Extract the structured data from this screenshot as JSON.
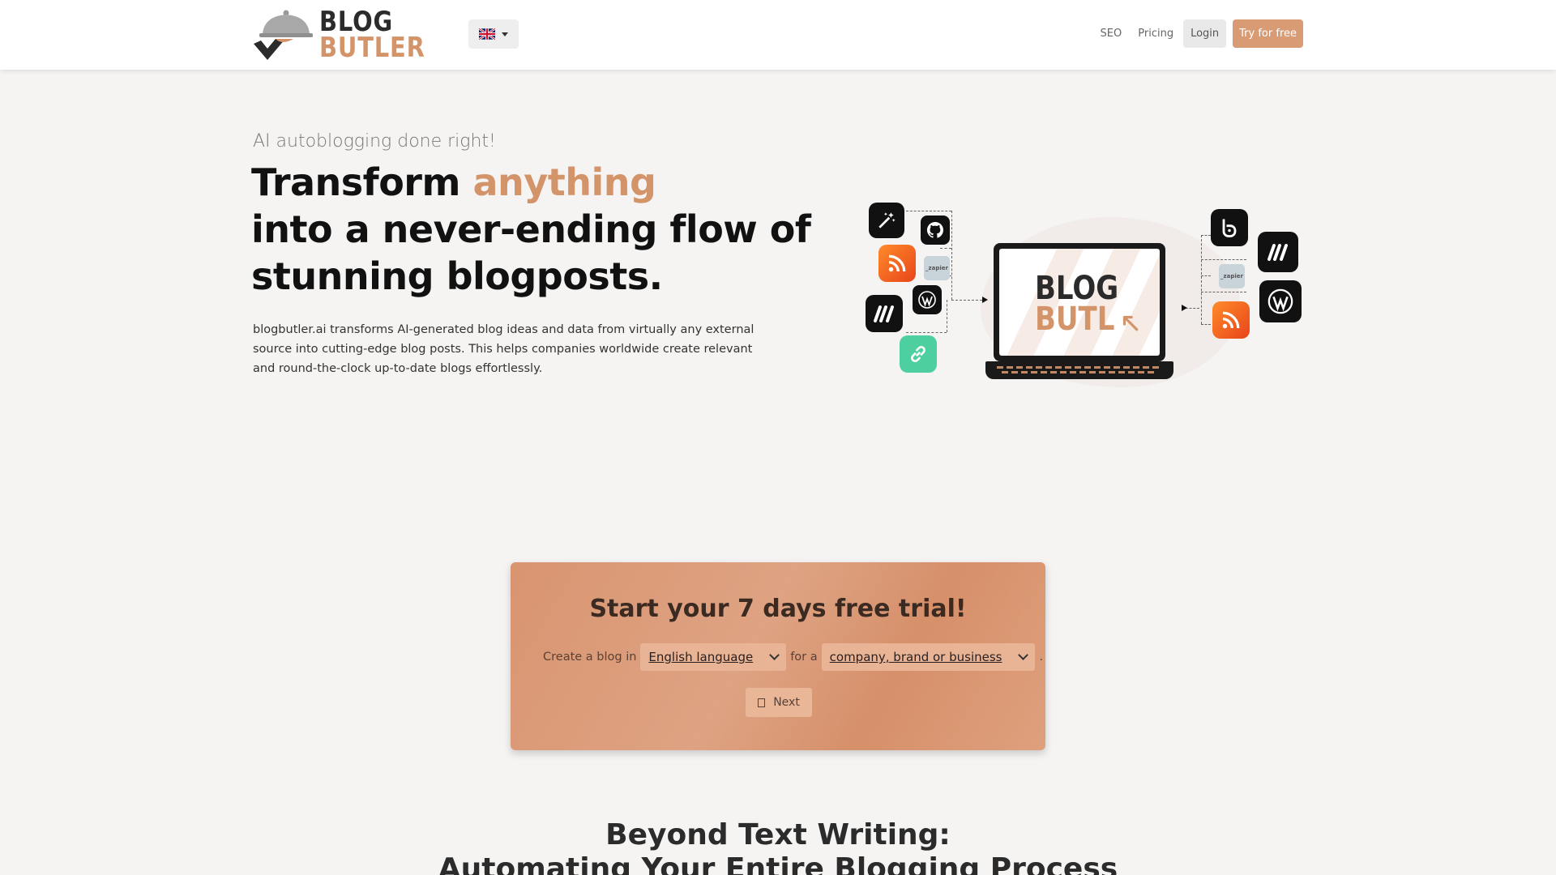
{
  "brand": {
    "line1": "BLOG",
    "line2": "BUTLER"
  },
  "nav": {
    "language": "en-GB",
    "links": [
      "SEO",
      "Pricing"
    ],
    "login_label": "Login",
    "try_label": "Try for free"
  },
  "hero": {
    "tagline": "AI autoblogging done right!",
    "headline_part1": "Transform ",
    "headline_accent": "anything",
    "headline_line2": "into a never-ending flow of",
    "headline_line3": "stunning blogposts.",
    "description": "blogbutler.ai transforms AI-generated blog ideas and data from virtually any external source into cutting-edge blog posts. This helps companies worldwide create relevant and round-the-clock up-to-date blogs effortlessly."
  },
  "illustration": {
    "laptop_line1": "BLOG",
    "laptop_line2": "BUTL",
    "zapier_label": "_zapier",
    "input_icons": [
      "magic-wand-icon",
      "github-icon",
      "rss-icon",
      "zapier-icon",
      "make-icon",
      "wordpress-icon",
      "link-icon"
    ],
    "output_icons": [
      "blogger-icon",
      "make-icon",
      "zapier-icon",
      "wordpress-icon",
      "rss-icon"
    ]
  },
  "trial": {
    "title": "Start your 7 days free trial!",
    "prefix": "Create a blog in",
    "language_value": "English language",
    "connector": "for a",
    "audience_value": "company, brand or business",
    "suffix": ".",
    "next_label": "Next"
  },
  "section": {
    "title_line1": "Beyond Text Writing:",
    "title_line2": "Automating Your Entire Blogging Process"
  },
  "colors": {
    "accent": "#d4946a",
    "card": "#dc9a75",
    "text": "#111111"
  }
}
